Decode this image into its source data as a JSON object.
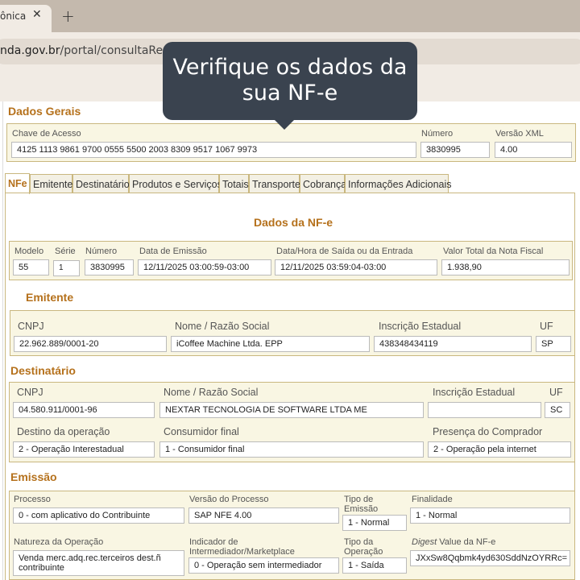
{
  "browser": {
    "tab_title": "ônica",
    "close_glyph": "✕",
    "newtab_glyph": "+",
    "url_domain": "nda.gov.br",
    "url_path": "/portal/consultaResum"
  },
  "tooltip": {
    "line1": "Verifique os dados da",
    "line2": "sua NF-e"
  },
  "dados_gerais": {
    "title": "Dados Gerais",
    "chave_label": "Chave de Acesso",
    "chave_value": "4125 1113 9861 9700 0555 5500 2003 8309 9517 1067 9973",
    "numero_label": "Número",
    "numero_value": "3830995",
    "versao_label": "Versão XML",
    "versao_value": "4.00"
  },
  "tabs": [
    {
      "label": "NFe"
    },
    {
      "label": "Emitente"
    },
    {
      "label": "Destinatário"
    },
    {
      "label": "Produtos e Serviços"
    },
    {
      "label": "Totais"
    },
    {
      "label": "Transporte"
    },
    {
      "label": "Cobrança"
    },
    {
      "label": "Informações Adicionais"
    }
  ],
  "dados_nfe": {
    "title": "Dados da NF-e",
    "modelo_label": "Modelo",
    "modelo_value": "55",
    "serie_label": "Série",
    "serie_value": "1",
    "numero_label": "Número",
    "numero_value": "3830995",
    "emissao_label": "Data de Emissão",
    "emissao_value": "12/11/2025 03:00:59-03:00",
    "saida_label": "Data/Hora de Saída ou da Entrada",
    "saida_value": "12/11/2025 03:59:04-03:00",
    "valor_label": "Valor Total da Nota Fiscal",
    "valor_value": "1.938,90"
  },
  "emitente": {
    "title": "Emitente",
    "cnpj_label": "CNPJ",
    "cnpj_value": "22.962.889/0001-20",
    "nome_label": "Nome / Razão Social",
    "nome_value": "iCoffee Machine Ltda. EPP",
    "ie_label": "Inscrição Estadual",
    "ie_value": "438348434119",
    "uf_label": "UF",
    "uf_value": "SP"
  },
  "destinatario": {
    "title": "Destinatário",
    "cnpj_label": "CNPJ",
    "cnpj_value": "04.580.911/0001-96",
    "nome_label": "Nome / Razão Social",
    "nome_value": "NEXTAR TECNOLOGIA DE SOFTWARE LTDA ME",
    "ie_label": "Inscrição Estadual",
    "ie_value": "",
    "uf_label": "UF",
    "uf_value": "SC",
    "destino_label": "Destino da operação",
    "destino_value": "2 - Operação Interestadual",
    "consumidor_label": "Consumidor final",
    "consumidor_value": "1 - Consumidor final",
    "presenca_label": "Presença do Comprador",
    "presenca_value": "2 - Operação pela internet"
  },
  "emissao": {
    "title": "Emissão",
    "processo_label": "Processo",
    "processo_value": "0 - com aplicativo do Contribuinte",
    "versao_label": "Versão do Processo",
    "versao_value": "SAP NFE 4.00",
    "tipo_emissao_label_1": "Tipo de",
    "tipo_emissao_label_2": "Emissão",
    "tipo_emissao_value": "1 - Normal",
    "finalidade_label": "Finalidade",
    "finalidade_value": "1 - Normal",
    "natureza_label": "Natureza da Operação",
    "natureza_value_1": "Venda merc.adq.rec.terceiros dest.ñ",
    "natureza_value_2": "contribuinte",
    "indicador_label_1": "Indicador de",
    "indicador_label_2": "Intermediador/Marketplace",
    "indicador_value": "0 - Operação sem intermediador",
    "tipo_op_label_1": "Tipo da",
    "tipo_op_label_2": "Operação",
    "tipo_op_value": "1 - Saída",
    "digest_label_italic": "Digest",
    "digest_label_rest": " Value da NF-e",
    "digest_value": "JXxSw8Qqbmk4yd630SddNzOYRRc="
  }
}
